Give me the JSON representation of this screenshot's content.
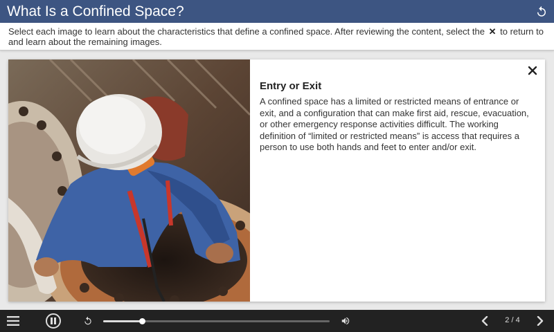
{
  "header": {
    "title": "What Is a Confined Space?",
    "restart_icon": "restart-icon"
  },
  "instructions": {
    "text_before": "Select each image to learn about the characteristics that define a confined space. After reviewing the content, select the",
    "x_symbol": "✕",
    "text_after": "to return to and learn about the remaining images."
  },
  "card": {
    "image_icon": "worker-entering-manhole-photo",
    "heading": "Entry or Exit",
    "body": "A confined space has a limited or restricted means of entrance or exit, and a configuration that can make first aid, rescue, evacuation, or other emergency response activities difficult. The working definition of “limited or restricted means” is access that requires a person to use both hands and feet to enter and/or exit.",
    "close_icon": "close-icon"
  },
  "player": {
    "menu_icon": "hamburger-menu-icon",
    "pause_icon": "pause-icon",
    "replay_icon": "replay-icon",
    "progress": 0.17,
    "volume_icon": "volume-icon",
    "prev_icon": "chevron-left-icon",
    "page_indicator": "2 / 4",
    "next_icon": "chevron-right-icon"
  },
  "colors": {
    "header_bg": "#3d5582",
    "player_bg": "#222222",
    "page_bg": "#e9e9e9"
  }
}
